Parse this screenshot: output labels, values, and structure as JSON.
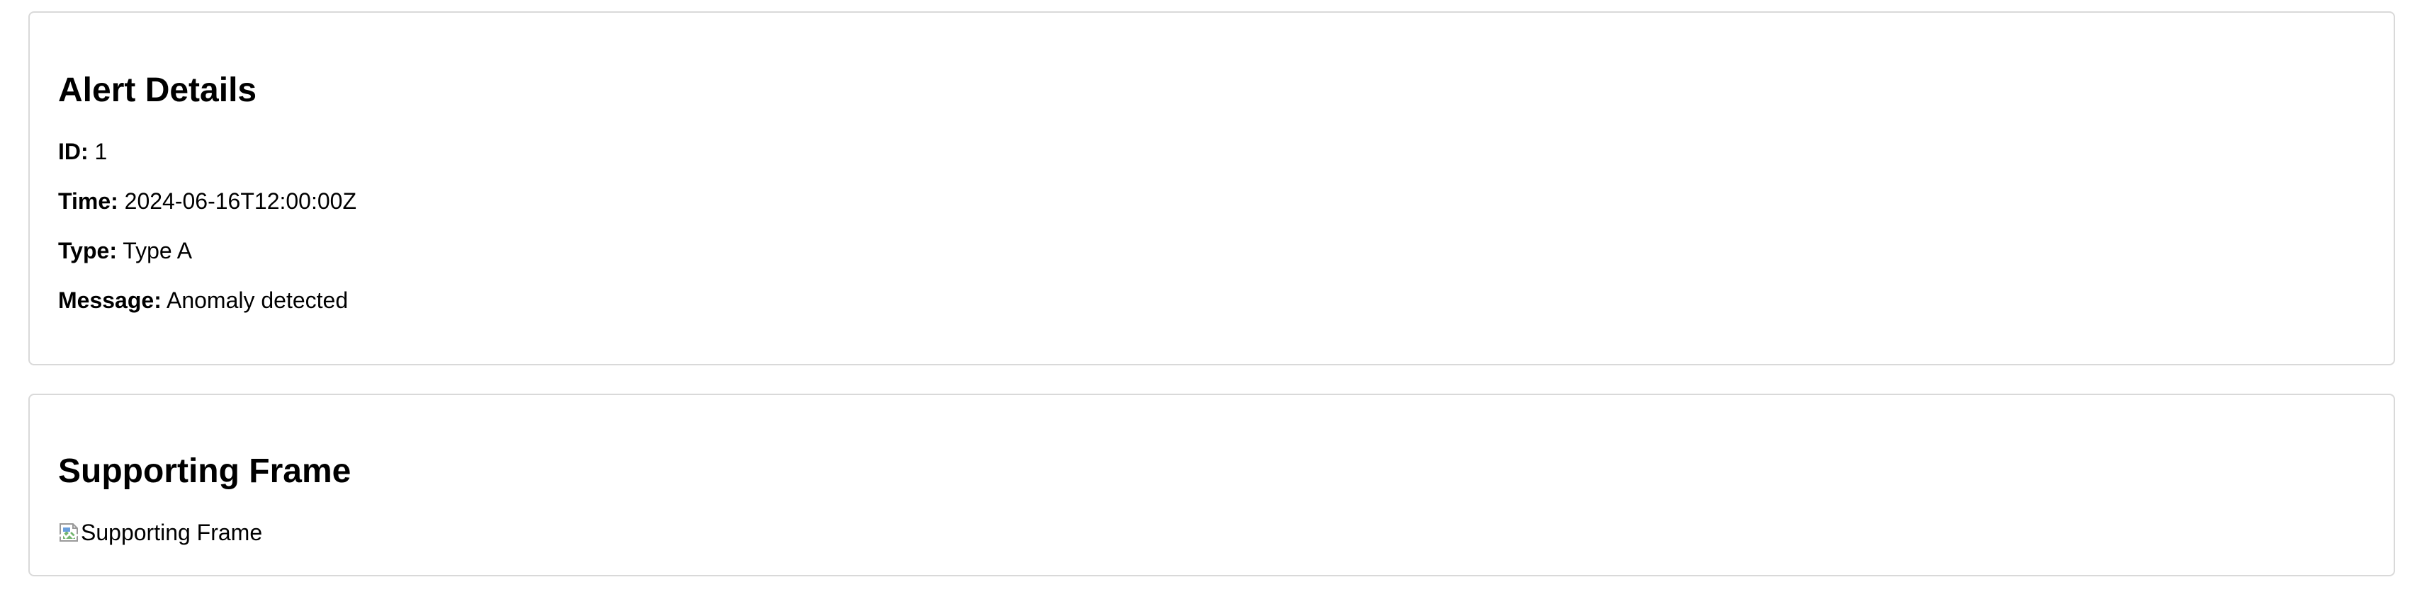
{
  "alert_details": {
    "title": "Alert Details",
    "fields": {
      "id": {
        "label": "ID:",
        "value": "1"
      },
      "time": {
        "label": "Time:",
        "value": "2024-06-16T12:00:00Z"
      },
      "type": {
        "label": "Type:",
        "value": "Type A"
      },
      "message": {
        "label": "Message:",
        "value": "Anomaly detected"
      }
    }
  },
  "supporting_frame": {
    "title": "Supporting Frame",
    "image_alt": "Supporting Frame",
    "image_icon": "broken-image-icon"
  }
}
